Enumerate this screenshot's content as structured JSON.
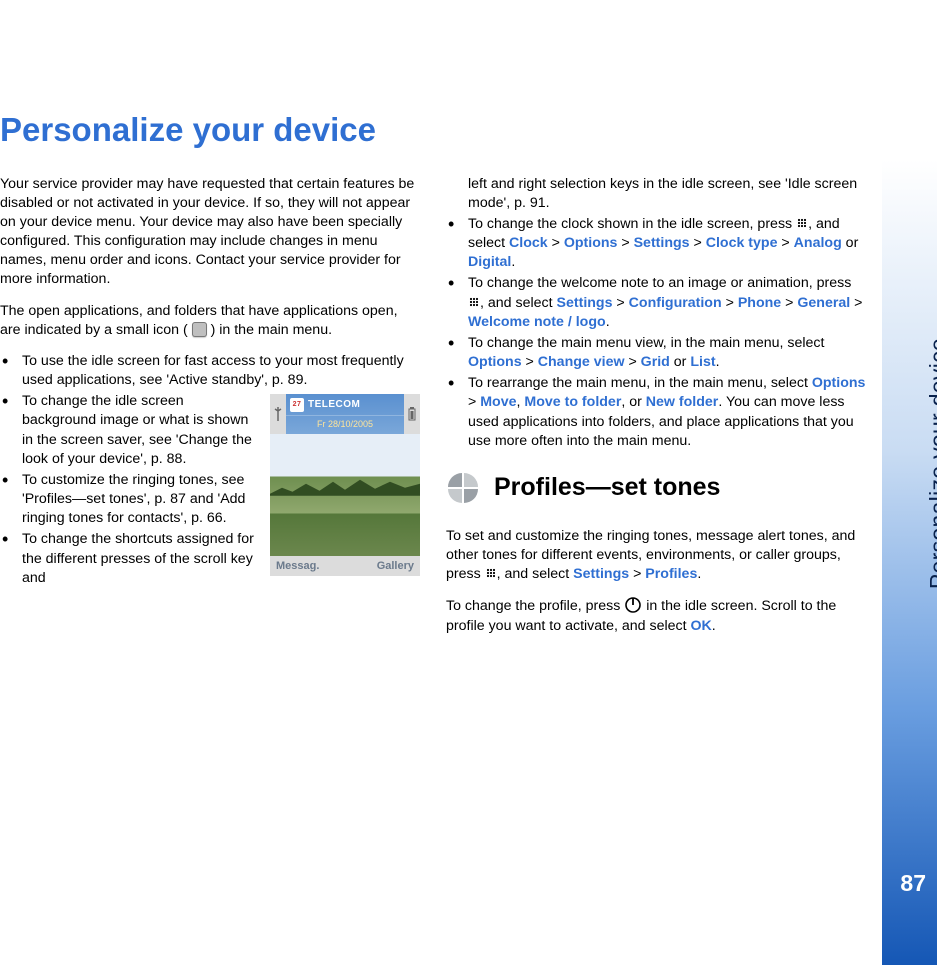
{
  "page": {
    "title": "Personalize your device",
    "tab_label": "Personalize your device",
    "number": "87"
  },
  "col_left": {
    "p1": "Your service provider may have requested that certain features be disabled or not activated in your device. If so, they will not appear on your device menu. Your device may also have been specially configured. This configuration may include changes in menu names, menu order and icons. Contact your service provider for more information.",
    "p2_a": "The open applications, and folders that have applications open, are indicated by a small icon (",
    "p2_b": ") in the main menu.",
    "b1": "To use the idle screen for fast access to your most frequently used applications, see 'Active standby', p. 89.",
    "b2": "To change the idle screen background image or what is shown in the screen saver, see 'Change the look of your device', p. 88.",
    "b3": "To customize the ringing tones, see 'Profiles—set tones', p. 87 and 'Add ringing tones for contacts', p. 66.",
    "b4": "To change the shortcuts assigned for the different presses of the scroll key and"
  },
  "phone": {
    "carrier": "TELECOM",
    "date": "Fr 28/10/2005",
    "cal_day": "27",
    "softkey_left": "Messag.",
    "softkey_right": "Gallery"
  },
  "col_right": {
    "b1_head": "left and right selection keys in the idle screen, see 'Idle screen mode', p. 91.",
    "b2": {
      "pre": "To change the clock shown in the idle screen, press ",
      "post": ", and select ",
      "Clock": "Clock",
      "Options": "Options",
      "Settings": "Settings",
      "Clock_type": "Clock type",
      "Analog": "Analog",
      "Digital": "Digital",
      "or": " or ",
      "gt": " > "
    },
    "b3": {
      "pre": "To change the welcome note to an image or animation, press ",
      "post": ", and select ",
      "Settings": "Settings",
      "Configuration": "Configuration",
      "Phone": "Phone",
      "General": "General",
      "Welcome": "Welcome note / logo",
      "gt": " > "
    },
    "b4": {
      "pre": "To change the main menu view, in the main menu, select ",
      "Options": "Options",
      "Change_view": "Change view",
      "Grid": "Grid",
      "List": "List",
      "or": " or ",
      "gt": " > "
    },
    "b5": {
      "pre": "To rearrange the main menu, in the main menu, select ",
      "Options": "Options",
      "Move": "Move",
      "Move_to_folder": "Move to folder",
      "New_folder": "New folder",
      "comma": ", ",
      "or": ", or ",
      "post": ". You can move less used applications into folders, and place applications that you use more often into the main menu.",
      "gt": " > "
    },
    "section_title": "Profiles—set tones",
    "p_tones": {
      "pre": "To set and customize the ringing tones, message alert tones, and other tones for different events, environments, or caller groups, press ",
      "post": ", and select ",
      "Settings": "Settings",
      "Profiles": "Profiles",
      "gt": " > "
    },
    "p_change": {
      "pre": "To change the profile, press ",
      "mid": " in the idle screen. Scroll to the profile you want to activate, and select ",
      "OK": "OK"
    }
  }
}
